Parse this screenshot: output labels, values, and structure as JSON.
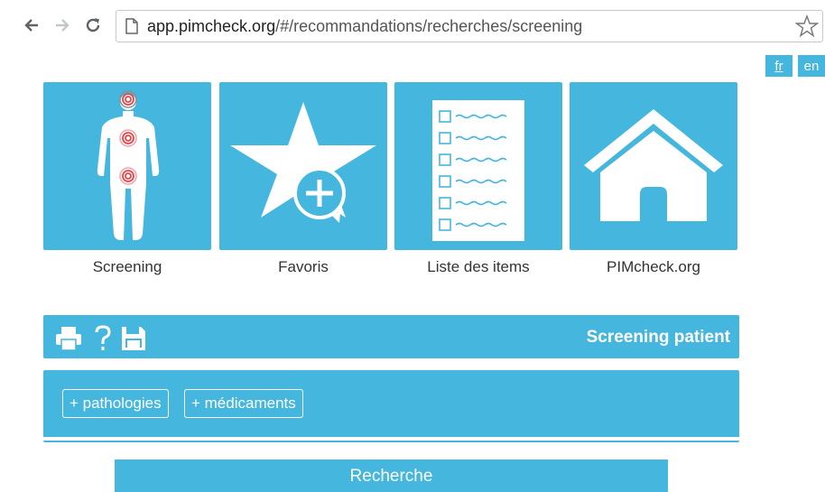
{
  "browser": {
    "url_host": "app.pimcheck.org",
    "url_path": "/#/recommandations/recherches/screening"
  },
  "languages": [
    {
      "label": "fr"
    },
    {
      "label": "en"
    }
  ],
  "tiles": [
    {
      "label": "Screening",
      "icon": "body-icon"
    },
    {
      "label": "Favoris",
      "icon": "star-plus-icon"
    },
    {
      "label": "Liste des items",
      "icon": "checklist-icon"
    },
    {
      "label": "PIMcheck.org",
      "icon": "home-icon"
    }
  ],
  "panel": {
    "title": "Screening patient",
    "icons": [
      "print-icon",
      "help-icon",
      "save-icon"
    ],
    "add_pathologies": "+ pathologies",
    "add_medicaments": "+ médicaments"
  },
  "search_button": "Recherche",
  "colors": {
    "accent": "#45b6de",
    "target": "#e8454a"
  }
}
